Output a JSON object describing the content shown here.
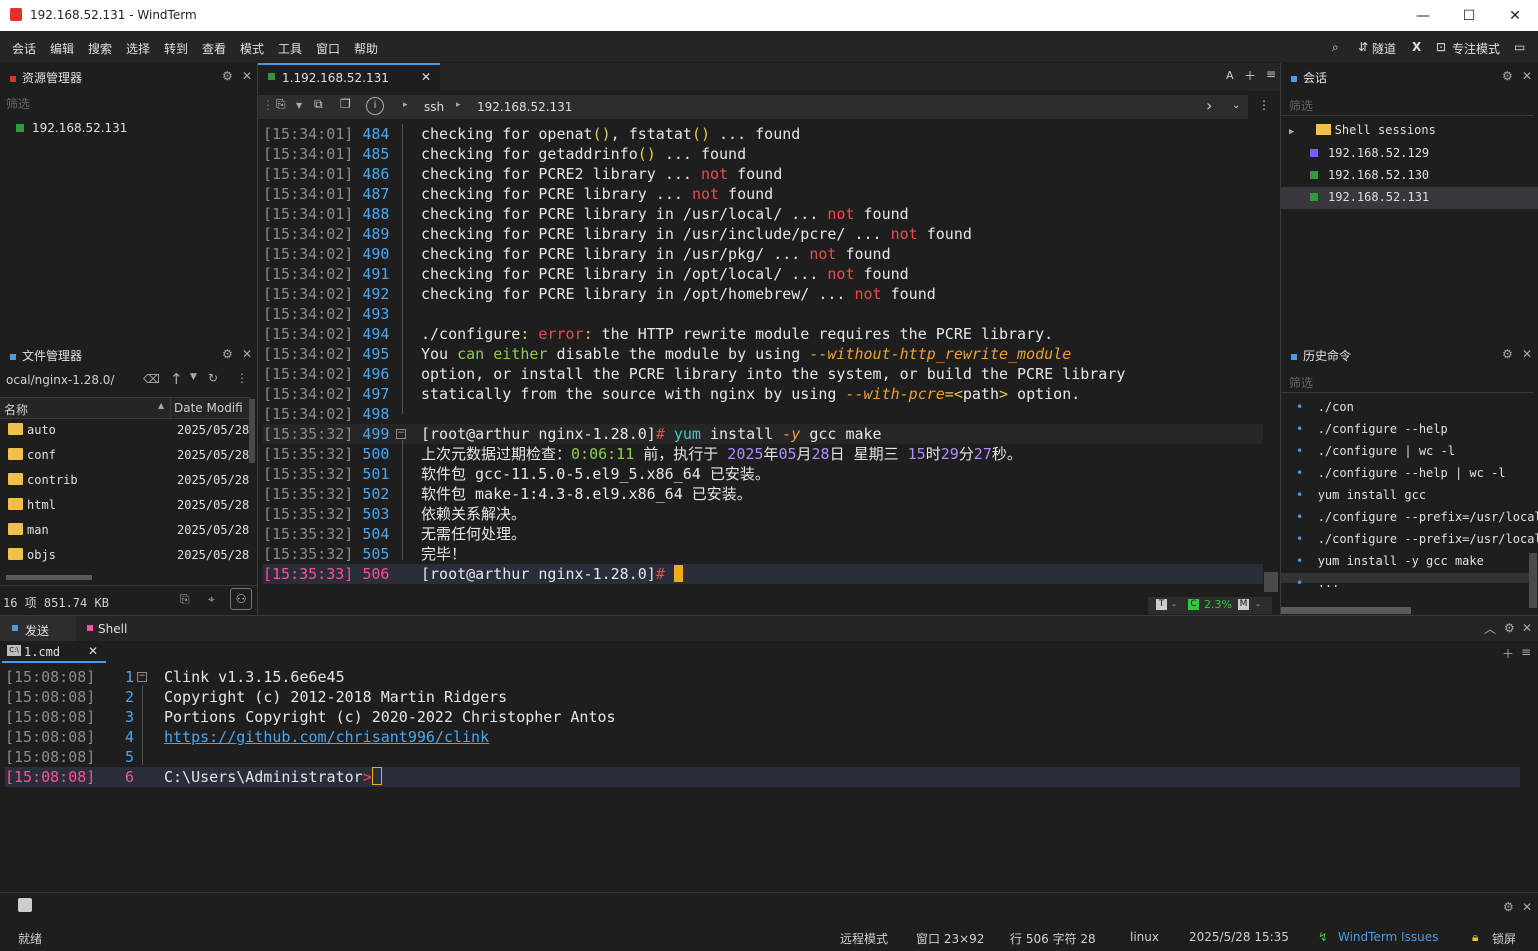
{
  "window": {
    "title": "192.168.52.131 - WindTerm"
  },
  "menu": {
    "items": [
      "会话",
      "编辑",
      "搜索",
      "选择",
      "转到",
      "查看",
      "模式",
      "工具",
      "窗口",
      "帮助"
    ],
    "tunnel_label": "隧道",
    "focus_label": "专注模式"
  },
  "explorer": {
    "title": "资源管理器",
    "filter_placeholder": "筛选",
    "items": [
      "192.168.52.131"
    ]
  },
  "filemanager": {
    "title": "文件管理器",
    "path": "ocal/nginx-1.28.0/",
    "columns": [
      "名称",
      "Date Modifi"
    ],
    "rows": [
      {
        "name": "auto",
        "date": "2025/05/28"
      },
      {
        "name": "conf",
        "date": "2025/05/28"
      },
      {
        "name": "contrib",
        "date": "2025/05/28"
      },
      {
        "name": "html",
        "date": "2025/05/28"
      },
      {
        "name": "man",
        "date": "2025/05/28"
      },
      {
        "name": "objs",
        "date": "2025/05/28"
      }
    ],
    "summary": "16 项 851.74 KB"
  },
  "terminal": {
    "tab_label": "1.192.168.52.131",
    "breadcrumb": [
      "ssh",
      "192.168.52.131"
    ],
    "lines": [
      {
        "ts": "[15:34:01]",
        "ln": "484",
        "parts": [
          [
            "txt",
            "checking for openat"
          ],
          [
            "yel",
            "()"
          ],
          [
            "txt",
            ", fstatat"
          ],
          [
            "yel",
            "()"
          ],
          [
            "txt",
            " ... found"
          ]
        ]
      },
      {
        "ts": "[15:34:01]",
        "ln": "485",
        "parts": [
          [
            "txt",
            "checking for getaddrinfo"
          ],
          [
            "yel",
            "()"
          ],
          [
            "txt",
            " ... found"
          ]
        ]
      },
      {
        "ts": "[15:34:01]",
        "ln": "486",
        "parts": [
          [
            "txt",
            "checking for PCRE2 library ... "
          ],
          [
            "red",
            "not"
          ],
          [
            "txt",
            " found"
          ]
        ]
      },
      {
        "ts": "[15:34:01]",
        "ln": "487",
        "parts": [
          [
            "txt",
            "checking for PCRE library ... "
          ],
          [
            "red",
            "not"
          ],
          [
            "txt",
            " found"
          ]
        ]
      },
      {
        "ts": "[15:34:01]",
        "ln": "488",
        "parts": [
          [
            "txt",
            "checking for PCRE library in /usr/local/ ... "
          ],
          [
            "red",
            "not"
          ],
          [
            "txt",
            " found"
          ]
        ]
      },
      {
        "ts": "[15:34:02]",
        "ln": "489",
        "parts": [
          [
            "txt",
            "checking for PCRE library in /usr/include/pcre/ ... "
          ],
          [
            "red",
            "not"
          ],
          [
            "txt",
            " found"
          ]
        ]
      },
      {
        "ts": "[15:34:02]",
        "ln": "490",
        "parts": [
          [
            "txt",
            "checking for PCRE library in /usr/pkg/ ... "
          ],
          [
            "red",
            "not"
          ],
          [
            "txt",
            " found"
          ]
        ]
      },
      {
        "ts": "[15:34:02]",
        "ln": "491",
        "parts": [
          [
            "txt",
            "checking for PCRE library in /opt/local/ ... "
          ],
          [
            "red",
            "not"
          ],
          [
            "txt",
            " found"
          ]
        ]
      },
      {
        "ts": "[15:34:02]",
        "ln": "492",
        "parts": [
          [
            "txt",
            "checking for PCRE library in /opt/homebrew/ ... "
          ],
          [
            "red",
            "not"
          ],
          [
            "txt",
            " found"
          ]
        ]
      },
      {
        "ts": "[15:34:02]",
        "ln": "493",
        "parts": []
      },
      {
        "ts": "[15:34:02]",
        "ln": "494",
        "parts": [
          [
            "txt",
            "./configure"
          ],
          [
            "yel",
            ":"
          ],
          [
            "txt",
            " "
          ],
          [
            "red",
            "error"
          ],
          [
            "yel",
            ":"
          ],
          [
            "txt",
            " the HTTP rewrite module requires the PCRE library."
          ]
        ]
      },
      {
        "ts": "[15:34:02]",
        "ln": "495",
        "parts": [
          [
            "txt",
            "You "
          ],
          [
            "grn",
            "can either"
          ],
          [
            "txt",
            " disable the module by using "
          ],
          [
            "org",
            "--without-http_rewrite_module"
          ]
        ]
      },
      {
        "ts": "[15:34:02]",
        "ln": "496",
        "parts": [
          [
            "txt",
            "option, or install the PCRE library into the system, or build the PCRE library"
          ]
        ]
      },
      {
        "ts": "[15:34:02]",
        "ln": "497",
        "parts": [
          [
            "txt",
            "statically from the source with nginx by using "
          ],
          [
            "org",
            "--with-pcre"
          ],
          [
            "yel",
            "=<"
          ],
          [
            "txt",
            "path"
          ],
          [
            "yel",
            ">"
          ],
          [
            "txt",
            " option."
          ]
        ]
      },
      {
        "ts": "[15:34:02]",
        "ln": "498",
        "parts": []
      },
      {
        "ts": "[15:35:32]",
        "ln": "499",
        "parts": [
          [
            "txt",
            "[root@arthur nginx-1.28.0]"
          ],
          [
            "red",
            "#"
          ],
          [
            "txt",
            " "
          ],
          [
            "cyan",
            "yum"
          ],
          [
            "txt",
            " install "
          ],
          [
            "org",
            "-y"
          ],
          [
            "txt",
            " gcc make"
          ]
        ]
      },
      {
        "ts": "[15:35:32]",
        "ln": "500",
        "parts": [
          [
            "txt",
            "上次元数据过期检查："
          ],
          [
            "grn",
            "0:06:11"
          ],
          [
            "txt",
            " 前，执行于 "
          ],
          [
            "pur",
            "2025"
          ],
          [
            "txt",
            "年"
          ],
          [
            "pur",
            "05"
          ],
          [
            "txt",
            "月"
          ],
          [
            "pur",
            "28"
          ],
          [
            "txt",
            "日 星期三 "
          ],
          [
            "pur",
            "15"
          ],
          [
            "txt",
            "时"
          ],
          [
            "pur",
            "29"
          ],
          [
            "txt",
            "分"
          ],
          [
            "pur",
            "27"
          ],
          [
            "txt",
            "秒。"
          ]
        ]
      },
      {
        "ts": "[15:35:32]",
        "ln": "501",
        "parts": [
          [
            "txt",
            "软件包 gcc-11.5.0-5.el9_5.x86_64 已安装。"
          ]
        ]
      },
      {
        "ts": "[15:35:32]",
        "ln": "502",
        "parts": [
          [
            "txt",
            "软件包 make-1:4.3-8.el9.x86_64 已安装。"
          ]
        ]
      },
      {
        "ts": "[15:35:32]",
        "ln": "503",
        "parts": [
          [
            "txt",
            "依赖关系解决。"
          ]
        ]
      },
      {
        "ts": "[15:35:32]",
        "ln": "504",
        "parts": [
          [
            "txt",
            "无需任何处理。"
          ]
        ]
      },
      {
        "ts": "[15:35:32]",
        "ln": "505",
        "parts": [
          [
            "txt",
            "完毕！"
          ]
        ]
      },
      {
        "ts": "[15:35:33]",
        "ln": "506",
        "parts": [
          [
            "txt",
            "[root@arthur nginx-1.28.0]"
          ],
          [
            "red",
            "#"
          ],
          [
            "txt",
            " "
          ]
        ],
        "current": true
      }
    ],
    "status_pct": "2.3%"
  },
  "sessions": {
    "title": "会话",
    "filter_placeholder": "筛选",
    "group": "Shell sessions",
    "items": [
      {
        "label": "192.168.52.129",
        "color": "#7a5cff"
      },
      {
        "label": "192.168.52.130",
        "color": "#2e9b3e"
      },
      {
        "label": "192.168.52.131",
        "color": "#2e9b3e"
      }
    ]
  },
  "history": {
    "title": "历史命令",
    "filter_placeholder": "筛选",
    "items": [
      "./con",
      "./configure --help",
      "./configure | wc -l",
      "./configure --help | wc -l",
      "yum install gcc",
      "./configure --prefix=/usr/local",
      "./configure --prefix=/usr/local",
      "yum install -y gcc make",
      "..."
    ]
  },
  "bottom": {
    "tabs": [
      "发送",
      "Shell"
    ],
    "subtab": "1.cmd",
    "lines": [
      {
        "ts": "[15:08:08]",
        "ln": "1",
        "text": "Clink v1.3.15.6e6e45"
      },
      {
        "ts": "[15:08:08]",
        "ln": "2",
        "text": "Copyright (c) 2012-2018 Martin Ridgers"
      },
      {
        "ts": "[15:08:08]",
        "ln": "3",
        "text": "Portions Copyright (c) 2020-2022 Christopher Antos"
      },
      {
        "ts": "[15:08:08]",
        "ln": "4",
        "text": "https://github.com/chrisant996/clink"
      },
      {
        "ts": "[15:08:08]",
        "ln": "5",
        "text": ""
      },
      {
        "ts": "[15:08:08]",
        "ln": "6",
        "text": "C:\\Users\\Administrator"
      }
    ],
    "prompt_char": ">"
  },
  "statusbar": {
    "ready": "就绪",
    "mode": "远程模式",
    "window": "窗口 23×92",
    "position": "行 506 字符 28",
    "os": "linux",
    "datetime": "2025/5/28 15:35",
    "issues": "WindTerm Issues",
    "lock": "锁屏"
  }
}
